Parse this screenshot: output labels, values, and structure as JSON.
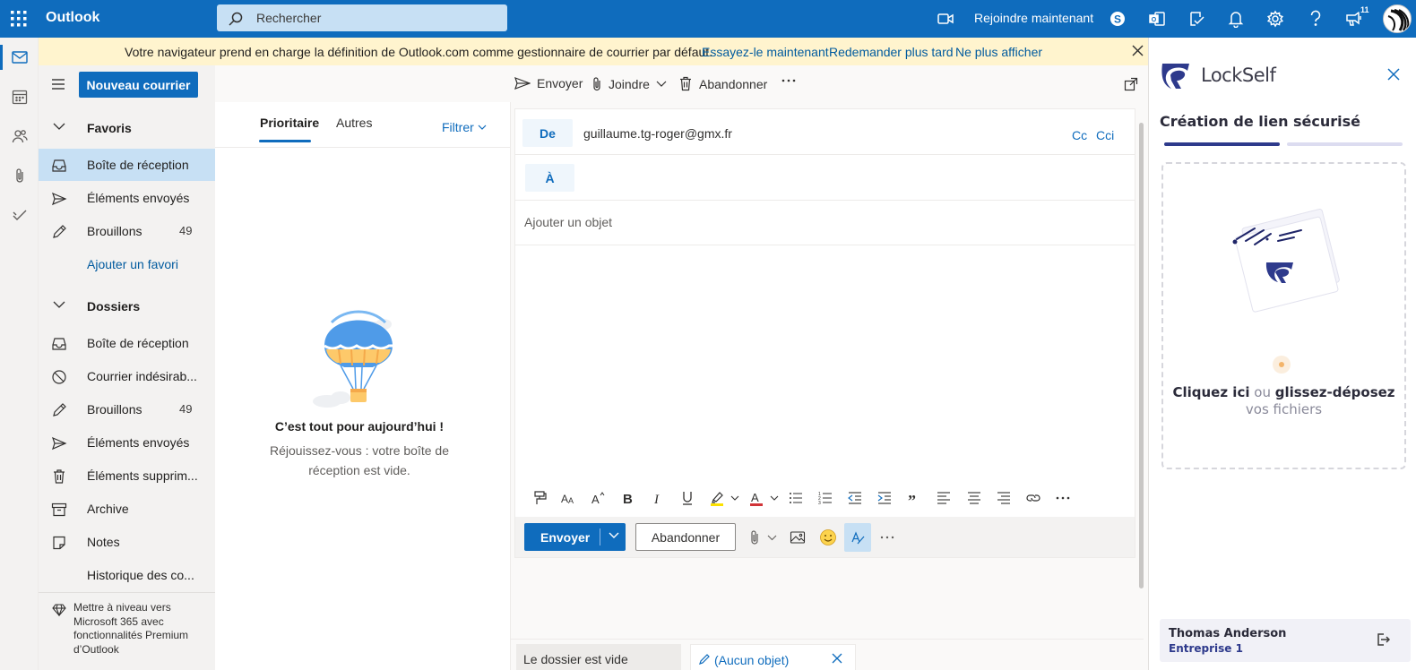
{
  "app": {
    "brand": "Outlook",
    "search_placeholder": "Rechercher",
    "join_now_label": "Rejoindre maintenant",
    "notification_count": "11",
    "accent": "#0f6cbd"
  },
  "banner": {
    "message": "Votre navigateur prend en charge la définition de Outlook.com comme gestionnaire de courrier par défaut.",
    "try_label": "Essayez-le maintenant",
    "later_label": "Redemander plus tard",
    "never_label": "Ne plus afficher"
  },
  "folder_pane": {
    "new_mail_label": "Nouveau courrier",
    "favorites_label": "Favoris",
    "favorites": [
      {
        "label": "Boîte de réception",
        "icon": "inbox-icon"
      },
      {
        "label": "Éléments envoyés",
        "icon": "send-icon"
      },
      {
        "label": "Brouillons",
        "count": "49",
        "icon": "pencil-icon"
      }
    ],
    "add_favorite_label": "Ajouter un favori",
    "folders_label": "Dossiers",
    "folders": [
      {
        "label": "Boîte de réception",
        "icon": "inbox-icon"
      },
      {
        "label": "Courrier indésirab...",
        "icon": "blocked-icon"
      },
      {
        "label": "Brouillons",
        "count": "49",
        "icon": "pencil-icon"
      },
      {
        "label": "Éléments envoyés",
        "icon": "send-icon"
      },
      {
        "label": "Éléments supprim...",
        "icon": "trash-icon"
      },
      {
        "label": "Archive",
        "icon": "archive-icon"
      },
      {
        "label": "Notes",
        "icon": "note-icon"
      },
      {
        "label": "Historique des co...",
        "icon": ""
      }
    ],
    "upgrade_text": "Mettre à niveau vers Microsoft 365 avec fonctionnalités Premium d’Outlook"
  },
  "command_bar": {
    "send_label": "Envoyer",
    "attach_label": "Joindre",
    "discard_label": "Abandonner"
  },
  "message_list": {
    "tab_focused": "Prioritaire",
    "tab_other": "Autres",
    "filter_label": "Filtrer",
    "empty_title": "C’est tout pour aujourd’hui !",
    "empty_subtitle": "Réjouissez-vous : votre boîte de réception est vide."
  },
  "compose": {
    "from_label": "De",
    "from_value": "guillaume.tg-roger@gmx.fr",
    "cc_label": "Cc",
    "bcc_label": "Cci",
    "to_label": "À",
    "subject_placeholder": "Ajouter un objet",
    "send_label": "Envoyer",
    "discard_label": "Abandonner"
  },
  "bottom_tabs": {
    "empty_folder_label": "Le dossier est vide",
    "draft_label": "(Aucun objet)"
  },
  "side_panel": {
    "brand": "LockSelf",
    "title": "Création de lien sécurisé",
    "drop_click": "Cliquez ici",
    "drop_or": "ou",
    "drop_drag": "glissez-déposez",
    "drop_files": "vos fichiers",
    "user_name": "Thomas Anderson",
    "user_org": "Entreprise 1",
    "brand_color": "#2e3a8c"
  }
}
